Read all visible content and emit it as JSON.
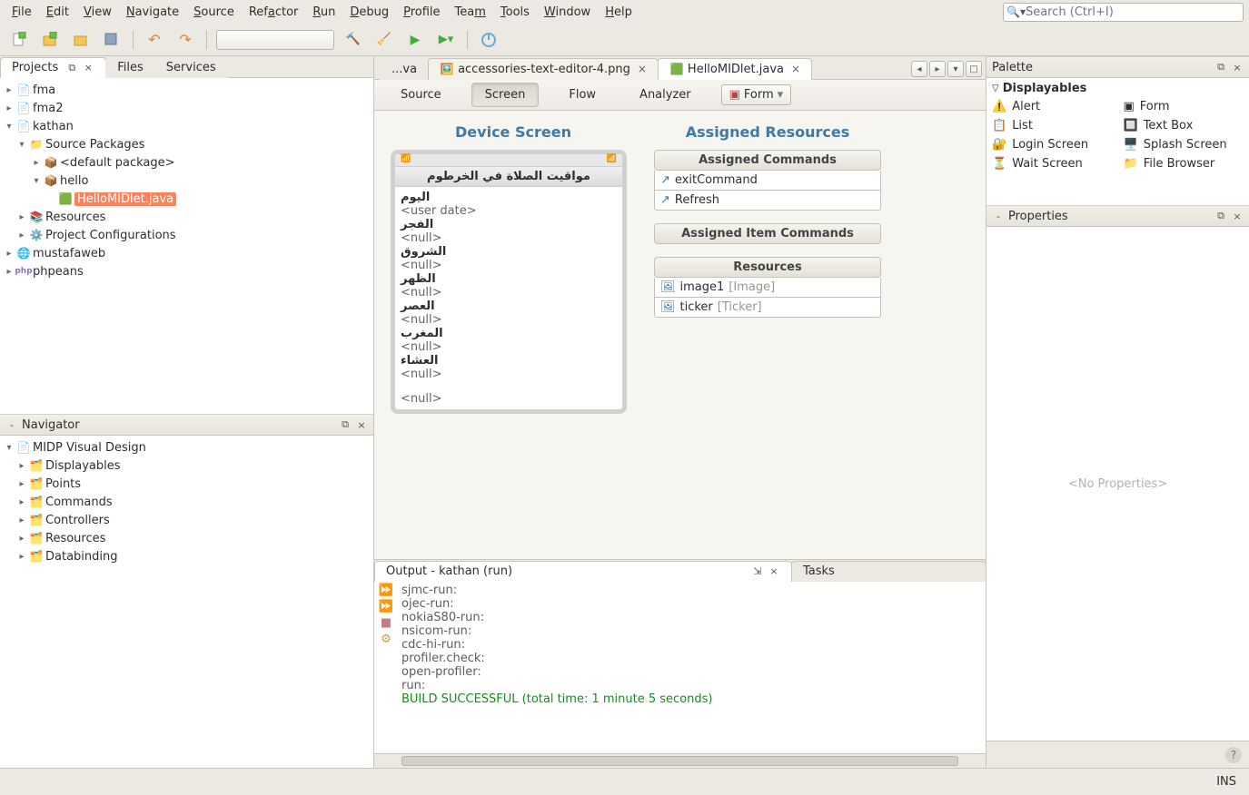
{
  "menu": {
    "file": "File",
    "edit": "Edit",
    "view": "View",
    "navigate": "Navigate",
    "source": "Source",
    "refactor": "Refactor",
    "run": "Run",
    "debug": "Debug",
    "profile": "Profile",
    "team": "Team",
    "tools": "Tools",
    "window": "Window",
    "help": "Help"
  },
  "search": {
    "placeholder": "Search (Ctrl+I)"
  },
  "left_tabs": {
    "projects": "Projects",
    "files": "Files",
    "services": "Services"
  },
  "projects": {
    "p1": "fma",
    "p2": "fma2",
    "p3": "kathan",
    "src": "Source Packages",
    "pkg_default": "<default package>",
    "pkg_hello": "hello",
    "file": "HelloMIDlet.java",
    "res": "Resources",
    "cfg": "Project Configurations",
    "p4": "mustafaweb",
    "p5": "phpeans"
  },
  "navigator": {
    "title": "Navigator",
    "root": "MIDP Visual Design",
    "n1": "Displayables",
    "n2": "Points",
    "n3": "Commands",
    "n4": "Controllers",
    "n5": "Resources",
    "n6": "Databinding"
  },
  "editor_tabs": {
    "t1": "...va",
    "t2": "accessories-text-editor-4.png",
    "t3": "HelloMIDlet.java"
  },
  "viewbar": {
    "source": "Source",
    "screen": "Screen",
    "flow": "Flow",
    "analyzer": "Analyzer",
    "form": "Form"
  },
  "designer": {
    "device_hdr": "Device Screen",
    "assigned_hdr": "Assigned Resources",
    "phone_title": "مواقيت الصلاة في الخرطوم",
    "l1": "اليوم",
    "v1": "<user date>",
    "l2": "الفجر",
    "l3": "الشروق",
    "l4": "الظهر",
    "l5": "العصر",
    "l6": "المغرب",
    "l7": "العشاء",
    "nul": "<null>",
    "grp1": "Assigned Commands",
    "cmd1": "exitCommand",
    "cmd2": "Refresh",
    "grp2": "Assigned Item Commands",
    "grp3": "Resources",
    "res1": "image1",
    "res1t": "[Image]",
    "res2": "ticker",
    "res2t": "[Ticker]"
  },
  "palette": {
    "title": "Palette",
    "cat": "Displayables",
    "i1": "Alert",
    "i2": "Form",
    "i3": "List",
    "i4": "Text Box",
    "i5": "Login Screen",
    "i6": "Splash Screen",
    "i7": "Wait Screen",
    "i8": "File Browser"
  },
  "properties": {
    "title": "Properties",
    "empty": "<No Properties>"
  },
  "output": {
    "title": "Output - kathan (run)",
    "tasks": "Tasks",
    "l1": "sjmc-run:",
    "l2": "ojec-run:",
    "l3": "nokiaS80-run:",
    "l4": "nsicom-run:",
    "l5": "cdc-hi-run:",
    "l6": "profiler.check:",
    "l7": "open-profiler:",
    "l8": "run:",
    "ok": "BUILD SUCCESSFUL (total time: 1 minute 5 seconds)"
  },
  "status": {
    "ins": "INS"
  }
}
